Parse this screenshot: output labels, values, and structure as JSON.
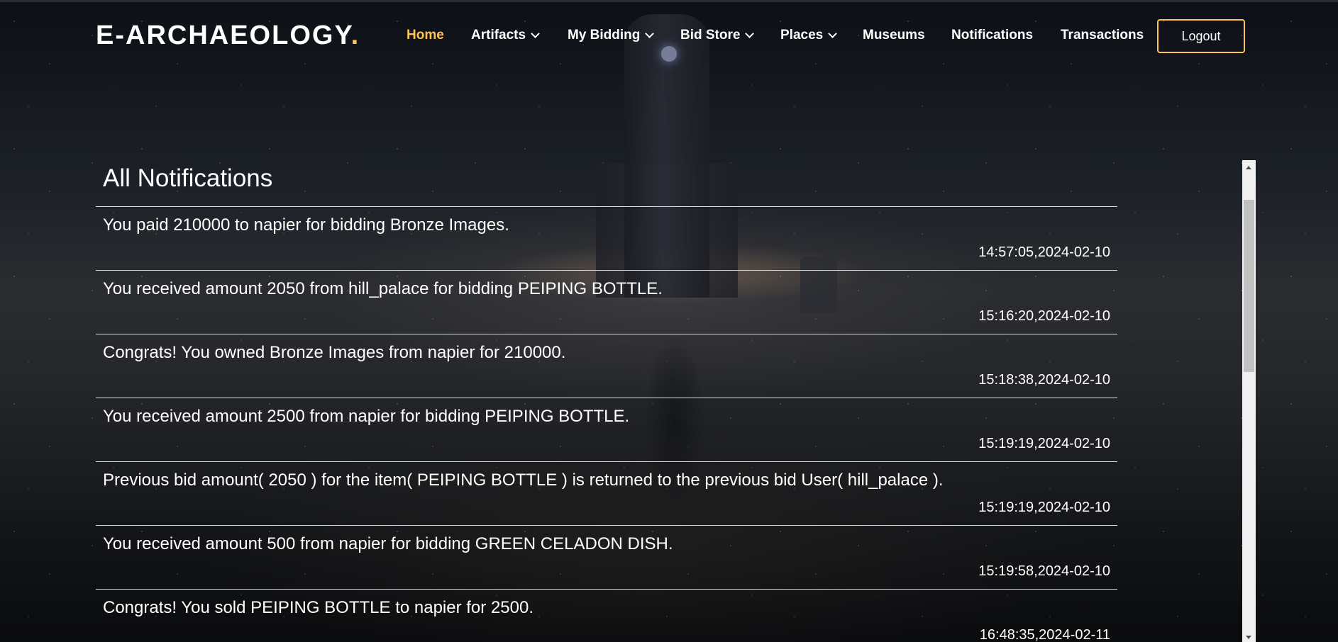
{
  "header": {
    "logo_text": "E-ARCHAEOLOGY",
    "logo_dot": ".",
    "nav": [
      {
        "label": "Home",
        "active": true,
        "dropdown": false
      },
      {
        "label": "Artifacts",
        "active": false,
        "dropdown": true
      },
      {
        "label": "My Bidding",
        "active": false,
        "dropdown": true
      },
      {
        "label": "Bid Store",
        "active": false,
        "dropdown": true
      },
      {
        "label": "Places",
        "active": false,
        "dropdown": true
      },
      {
        "label": "Museums",
        "active": false,
        "dropdown": false
      },
      {
        "label": "Notifications",
        "active": false,
        "dropdown": false
      },
      {
        "label": "Transactions",
        "active": false,
        "dropdown": false
      }
    ],
    "logout_label": "Logout"
  },
  "notifications": {
    "title": "All Notifications",
    "items": [
      {
        "message": "You paid 210000 to napier for bidding Bronze Images.",
        "time": "14:57:05,2024-02-10"
      },
      {
        "message": "You received amount 2050 from hill_palace for bidding PEIPING BOTTLE.",
        "time": "15:16:20,2024-02-10"
      },
      {
        "message": "Congrats! You owned Bronze Images from napier for 210000.",
        "time": "15:18:38,2024-02-10"
      },
      {
        "message": "You received amount 2500 from napier for bidding PEIPING BOTTLE.",
        "time": "15:19:19,2024-02-10"
      },
      {
        "message": "Previous bid amount( 2050 ) for the item( PEIPING BOTTLE ) is returned to the previous bid User( hill_palace ).",
        "time": "15:19:19,2024-02-10"
      },
      {
        "message": "You received amount 500 from napier for bidding GREEN CELADON DISH.",
        "time": "15:19:58,2024-02-10"
      },
      {
        "message": "Congrats! You sold PEIPING BOTTLE to napier for 2500.",
        "time": "16:48:35,2024-02-11"
      }
    ]
  },
  "colors": {
    "accent": "#ffc451",
    "text": "#ffffff",
    "divider": "#d9d9d9"
  },
  "icons": {
    "dropdown": "chevron-down-icon",
    "scroll_up": "arrow-up-icon",
    "scroll_down": "arrow-down-icon"
  }
}
